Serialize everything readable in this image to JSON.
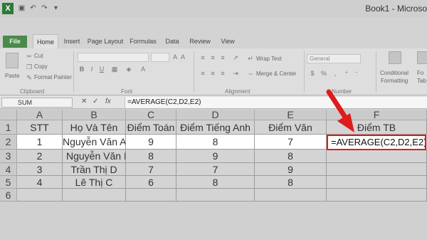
{
  "window": {
    "title": "Book1 - Microso"
  },
  "quick_access": {
    "save_icon": "save-icon",
    "undo_icon": "undo-icon",
    "redo_icon": "redo-icon"
  },
  "tabs": [
    {
      "label": "File"
    },
    {
      "label": "Home"
    },
    {
      "label": "Insert"
    },
    {
      "label": "Page Layout"
    },
    {
      "label": "Formulas"
    },
    {
      "label": "Data"
    },
    {
      "label": "Review"
    },
    {
      "label": "View"
    }
  ],
  "ribbon": {
    "paste": "Paste",
    "cut": "Cut",
    "copy": "Copy",
    "format_painter": "Format Painter",
    "clipboard": "Clipboard",
    "font": "Font",
    "alignment": "Alignment",
    "wrap_text": "Wrap Text",
    "merge_center": "Merge & Center",
    "number_format": "General",
    "number": "Number",
    "conditional_formatting_1": "Conditional",
    "conditional_formatting_2": "Formatting",
    "format_table_1": "Fo",
    "format_table_2": "Tab"
  },
  "formula_bar": {
    "name_box": "SUM",
    "cancel": "✕",
    "enter": "✓",
    "fx": "fx",
    "formula": "=AVERAGE(C2,D2,E2)"
  },
  "sheet": {
    "columns": [
      "A",
      "B",
      "C",
      "D",
      "E",
      "F"
    ],
    "rows": [
      "1",
      "2",
      "3",
      "4",
      "5",
      "6"
    ],
    "header": [
      "STT",
      "Họ Và Tên",
      "Điểm Toán",
      "Điểm Tiếng Anh",
      "Điểm Văn",
      "Điểm TB"
    ],
    "data": [
      [
        "1",
        "Nguyễn Văn A",
        "9",
        "8",
        "7",
        "=AVERAGE(C2,D2,E2)"
      ],
      [
        "2",
        "Nguyễn Văn B",
        "8",
        "9",
        "8",
        ""
      ],
      [
        "3",
        "Trần Thị D",
        "7",
        "7",
        "9",
        ""
      ],
      [
        "4",
        "Lê Thị C",
        "6",
        "8",
        "8",
        ""
      ]
    ]
  },
  "colors": {
    "highlight": "#e01b1b",
    "file_tab": "#4a8a4a",
    "excel_green": "#2a7a3a"
  }
}
